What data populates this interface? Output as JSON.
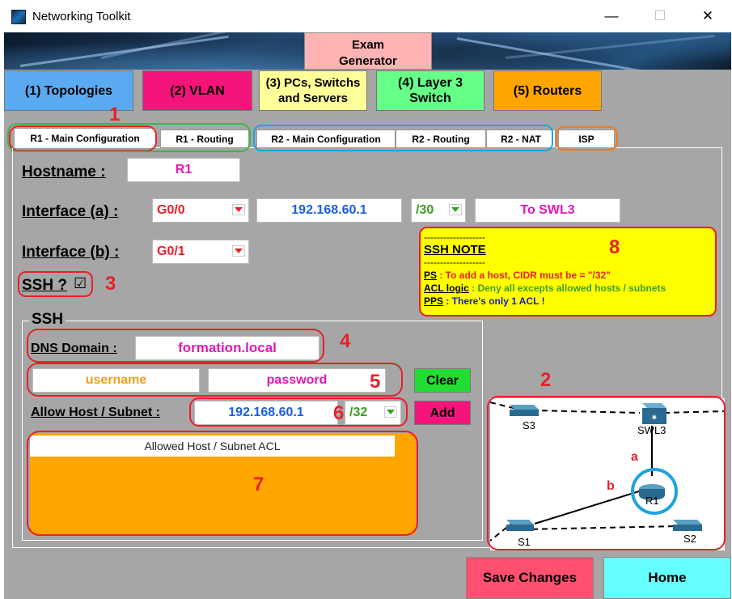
{
  "window": {
    "title": "Networking Toolkit",
    "minimize": "—",
    "maximize": "☐",
    "close": "✕"
  },
  "header": {
    "exam_generator": "Exam\nGenerator"
  },
  "nav": [
    {
      "label": "(1) Topologies",
      "color": "#5aaaf2"
    },
    {
      "label": "(2) VLAN",
      "color": "#f5157a"
    },
    {
      "label": "(3) PCs, Switchs\nand Servers",
      "color": "#ffff99"
    },
    {
      "label": "(4) Layer 3\nSwitch",
      "color": "#66ff88"
    },
    {
      "label": "(5) Routers",
      "color": "#ffa500"
    }
  ],
  "tabs": [
    {
      "label": "R1 - Main Configuration"
    },
    {
      "label": "R1 - Routing"
    },
    {
      "label": "R2 - Main Configuration"
    },
    {
      "label": "R2 - Routing"
    },
    {
      "label": "R2 - NAT"
    },
    {
      "label": "ISP"
    }
  ],
  "form": {
    "hostname_label": "Hostname :",
    "hostname_value": "R1",
    "iface_a_label": "Interface (a) :",
    "iface_a_value": "G0/0",
    "iface_a_ip": "192.168.60.1",
    "iface_a_cidr": "/30",
    "iface_a_desc": "To SWL3",
    "iface_b_label": "Interface (b) :",
    "iface_b_value": "G0/1",
    "ssh_label": "SSH ?",
    "ssh_checked": "☑"
  },
  "note": {
    "dashes": "-------------------",
    "title": "SSH NOTE",
    "ps_label": "PS",
    "ps_text": " : To add a host, CIDR must be = \"/32\"",
    "acl_label": "ACL logic",
    "acl_text": " : Deny all excepts allowed hosts / subnets",
    "pps_label": "PPS",
    "pps_text": " : There's only 1 ACL !"
  },
  "ssh": {
    "group_label": "SSH",
    "dns_label": "DNS Domain :",
    "dns_value": "formation.local",
    "username": "username",
    "password": "password",
    "clear": "Clear",
    "allow_label": "Allow Host / Subnet :",
    "allow_ip": "192.168.60.1",
    "allow_cidr": "/32",
    "add": "Add",
    "acl_header": "Allowed Host / Subnet ACL"
  },
  "topology": {
    "s3": "S3",
    "swl3": "SWL3",
    "r1": "R1",
    "s1": "S1",
    "s2": "S2",
    "link_a": "a",
    "link_b": "b"
  },
  "annotations": [
    "1",
    "2",
    "3",
    "4",
    "5",
    "6",
    "7",
    "8"
  ],
  "footer": {
    "save": "Save Changes",
    "home": "Home"
  }
}
